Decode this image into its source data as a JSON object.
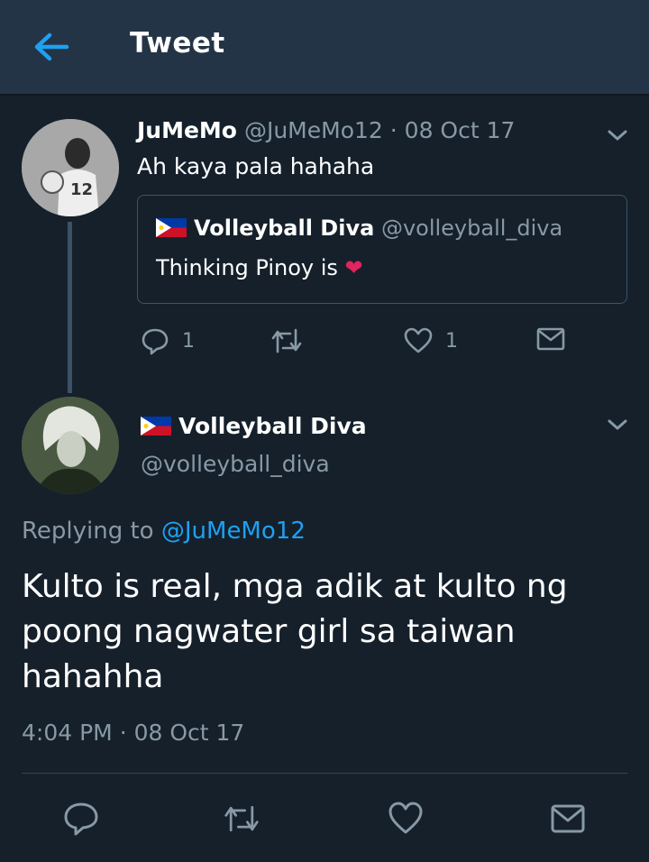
{
  "header": {
    "title": "Tweet",
    "back_icon": "arrow-left-icon",
    "accent": "#1da1f2"
  },
  "reply_tweet": {
    "name": "JuMeMo",
    "handle": "@JuMeMo12",
    "separator": "·",
    "date": "08 Oct 17",
    "text": "Ah kaya pala hahaha",
    "quoted": {
      "name": "Volleyball Diva",
      "handle": "@volleyball_diva",
      "text": "Thinking Pinoy is",
      "emoji": "❤"
    },
    "actions": {
      "reply_count": "1",
      "like_count": "1"
    }
  },
  "main_tweet": {
    "name": "Volleyball Diva",
    "handle": "@volleyball_diva",
    "replying_prefix": "Replying to",
    "replying_to": "@JuMeMo12",
    "text": "Kulto is real, mga adik at kulto ng poong nagwater girl sa taiwan hahahha",
    "time": "4:04 PM",
    "separator": "·",
    "date": "08 Oct 17"
  },
  "colors": {
    "background": "#15202b",
    "header": "#243447",
    "muted": "#8899a6",
    "heart": "#e0245e"
  }
}
